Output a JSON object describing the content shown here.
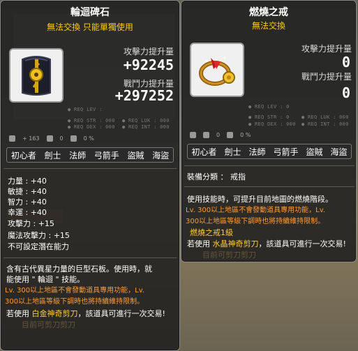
{
  "left": {
    "title": "輪迴碑石",
    "subtitle": "無法交換  只能單獨使用",
    "attack_label": "攻擊力提升量",
    "attack_value": "+92245",
    "battle_label": "戰鬥力提升量",
    "battle_value": "+297252",
    "req": {
      "lev": "● REQ LEV :",
      "str": "● REQ STR : 000",
      "luk": "● REQ LUK : 000",
      "dex": "● REQ DEX : 000",
      "int": "● REQ INT : 000"
    },
    "small_count": "+ 163",
    "small_pct1": "0",
    "small_pct2": "0 %",
    "jobs": [
      "初心者",
      "劍士",
      "法師",
      "弓箭手",
      "盜賊",
      "海盜"
    ],
    "stats": [
      "力量 : +40",
      "敏捷 : +40",
      "智力 : +40",
      "幸運 : +40",
      "攻擊力 : +15",
      "魔法攻擊力 : +15",
      "不可設定潛在能力"
    ],
    "desc1": "含有古代異星力量的巨型石板。使用時，就",
    "desc2": "能使用 \" 輪迴 \" 技能。",
    "desc3": "Lv. 300以上地區不會發動道具專用功能，Lv.",
    "desc4": "300以上地區等級下調時也將持續維持限制。",
    "desc5a": "若使用",
    "desc5b": "白金神奇剪刀",
    "desc5c": "，該道具可進行一次交易!",
    "desc6": "目前可剪刀剪刀"
  },
  "right": {
    "title": "燃燒之戒",
    "subtitle": "無法交換",
    "attack_label": "攻擊力提升量",
    "attack_value": "0",
    "battle_label": "戰鬥力提升量",
    "battle_value": "0",
    "req": {
      "lev": "● REQ LEV :   0",
      "str": "● REQ STR :   0",
      "luk": "● REQ LUK : 000",
      "dex": "● REQ DEX : 000",
      "int": "● REQ INT : 000"
    },
    "small_pct1": "0",
    "small_pct2": "0 %",
    "jobs": [
      "初心者",
      "劍士",
      "法師",
      "弓箭手",
      "盜賊",
      "海盜"
    ],
    "category": "裝備分類 ： 戒指",
    "desc1": "使用技能時，可提升目前地圖的燃燒階段。",
    "desc2": "Lv. 300以上地區不會發動道具專用功能，Lv.",
    "desc3": "300以上地區等級下調時也將持續維持限制。",
    "desc4": "燃燒之戒1級",
    "desc5a": "若使用",
    "desc5b": "水晶神奇剪刀",
    "desc5c": "，該道具可進行一次交易!",
    "desc6": "目前可剪刀剪刀"
  },
  "colors": {
    "tooltip_bg": "#1e1e1e",
    "gold": "#ffcc00",
    "orange": "#ff9933"
  }
}
